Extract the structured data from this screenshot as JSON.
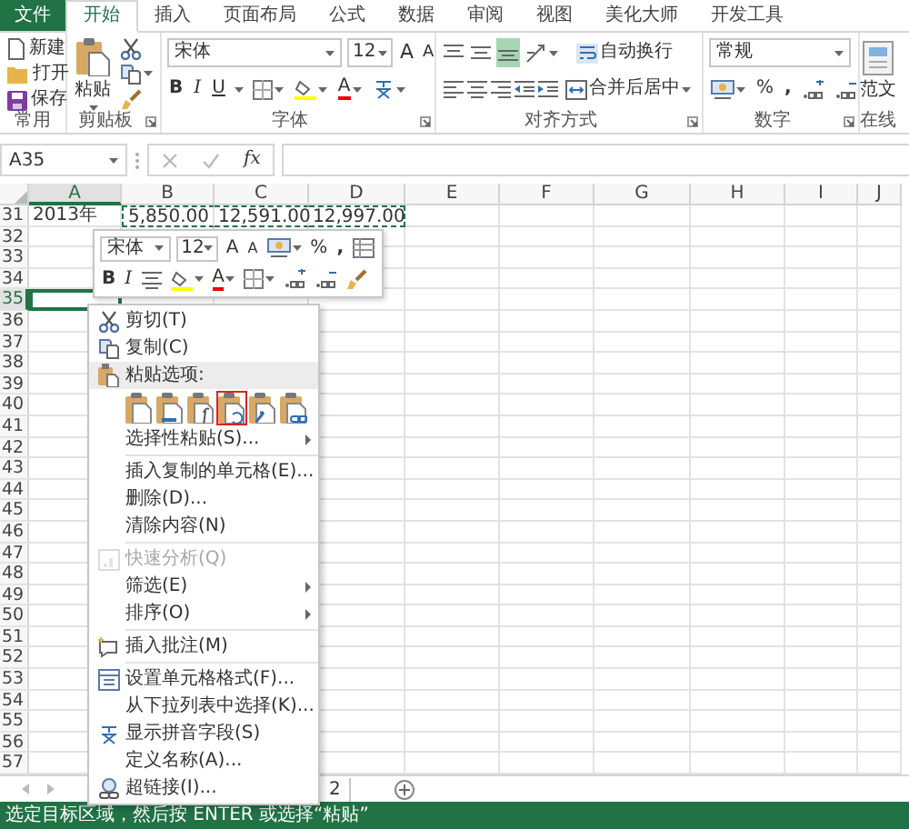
{
  "ribbon_tabs": [
    {
      "label": "文件",
      "kind": "file",
      "selected": false
    },
    {
      "label": "开始",
      "kind": "tab",
      "selected": true
    },
    {
      "label": "插入",
      "kind": "tab",
      "selected": false
    },
    {
      "label": "页面布局",
      "kind": "tab",
      "selected": false
    },
    {
      "label": "公式",
      "kind": "tab",
      "selected": false
    },
    {
      "label": "数据",
      "kind": "tab",
      "selected": false
    },
    {
      "label": "审阅",
      "kind": "tab",
      "selected": false
    },
    {
      "label": "视图",
      "kind": "tab",
      "selected": false
    },
    {
      "label": "美化大师",
      "kind": "tab",
      "selected": false
    },
    {
      "label": "开发工具",
      "kind": "tab",
      "selected": false
    }
  ],
  "ribbon": {
    "common": {
      "items": [
        "新建",
        "打开",
        "保存"
      ],
      "caption": "常用"
    },
    "clipboard": {
      "paste": "粘贴",
      "caption": "剪贴板"
    },
    "font": {
      "name": "宋体",
      "size": "12",
      "grow": "A",
      "shrink": "A",
      "bold": "B",
      "italic": "I",
      "underline": "U",
      "font_color": "A",
      "caption": "字体"
    },
    "alignment": {
      "wrap_text": "自动换行",
      "merge_center": "合并后居中",
      "caption": "对齐方式"
    },
    "number": {
      "format": "常规",
      "percent": "%",
      "comma": ",",
      "caption": "数字"
    },
    "online": {
      "button": "范文",
      "caption": "在线"
    }
  },
  "formula_bar": {
    "name_box": "A35",
    "function": "fx"
  },
  "columns": [
    {
      "label": "A",
      "selected": true
    },
    {
      "label": "B",
      "selected": false
    },
    {
      "label": "C",
      "selected": false
    },
    {
      "label": "D",
      "selected": false
    },
    {
      "label": "E",
      "selected": false
    },
    {
      "label": "F",
      "selected": false
    },
    {
      "label": "G",
      "selected": false
    },
    {
      "label": "H",
      "selected": false
    },
    {
      "label": "I",
      "selected": false
    },
    {
      "label": "J",
      "selected": false
    }
  ],
  "rows": [
    {
      "number": "31",
      "selected": false,
      "cells": [
        {
          "text": "2013年",
          "copied": false
        },
        {
          "text": "5,850.00",
          "copied": true
        },
        {
          "text": "12,591.00",
          "copied": true
        },
        {
          "text": "12,997.00",
          "copied": true
        }
      ]
    },
    {
      "number": "32",
      "selected": false
    },
    {
      "number": "33",
      "selected": false
    },
    {
      "number": "34",
      "selected": false
    },
    {
      "number": "35",
      "selected": true
    },
    {
      "number": "36",
      "selected": false
    },
    {
      "number": "37",
      "selected": false
    },
    {
      "number": "38",
      "selected": false
    },
    {
      "number": "39",
      "selected": false
    },
    {
      "number": "40",
      "selected": false
    },
    {
      "number": "41",
      "selected": false
    },
    {
      "number": "42",
      "selected": false
    },
    {
      "number": "43",
      "selected": false
    },
    {
      "number": "44",
      "selected": false
    },
    {
      "number": "45",
      "selected": false
    },
    {
      "number": "46",
      "selected": false
    },
    {
      "number": "47",
      "selected": false
    },
    {
      "number": "48",
      "selected": false
    },
    {
      "number": "49",
      "selected": false
    },
    {
      "number": "50",
      "selected": false
    },
    {
      "number": "51",
      "selected": false
    },
    {
      "number": "52",
      "selected": false
    },
    {
      "number": "53",
      "selected": false
    },
    {
      "number": "54",
      "selected": false
    },
    {
      "number": "55",
      "selected": false
    },
    {
      "number": "56",
      "selected": false
    },
    {
      "number": "57",
      "selected": false
    }
  ],
  "mini_toolbar": {
    "font": "宋体",
    "size": "12",
    "grow": "A",
    "shrink": "A",
    "percent": "%",
    "comma": ",",
    "bold": "B",
    "italic": "I",
    "font_color": "A"
  },
  "context_menu": {
    "items": [
      {
        "kind": "item",
        "label": "剪切(T)",
        "disabled": false,
        "submenu": false
      },
      {
        "kind": "item",
        "label": "复制(C)",
        "disabled": false,
        "submenu": false
      },
      {
        "kind": "header",
        "label": "粘贴选项:"
      },
      {
        "kind": "paste_options",
        "options": [
          {
            "selected": false
          },
          {
            "selected": false
          },
          {
            "selected": false
          },
          {
            "selected": true
          },
          {
            "selected": false
          },
          {
            "selected": false
          }
        ]
      },
      {
        "kind": "item",
        "label": "选择性粘贴(S)...",
        "disabled": false,
        "submenu": true
      },
      {
        "kind": "separator"
      },
      {
        "kind": "item",
        "label": "插入复制的单元格(E)...",
        "disabled": false,
        "submenu": false
      },
      {
        "kind": "item",
        "label": "删除(D)...",
        "disabled": false,
        "submenu": false
      },
      {
        "kind": "item",
        "label": "清除内容(N)",
        "disabled": false,
        "submenu": false
      },
      {
        "kind": "separator"
      },
      {
        "kind": "item",
        "label": "快速分析(Q)",
        "disabled": true,
        "submenu": false
      },
      {
        "kind": "item",
        "label": "筛选(E)",
        "disabled": false,
        "submenu": true
      },
      {
        "kind": "item",
        "label": "排序(O)",
        "disabled": false,
        "submenu": true
      },
      {
        "kind": "separator"
      },
      {
        "kind": "item",
        "label": "插入批注(M)",
        "disabled": false,
        "submenu": false
      },
      {
        "kind": "separator"
      },
      {
        "kind": "item",
        "label": "设置单元格格式(F)...",
        "disabled": false,
        "submenu": false
      },
      {
        "kind": "item",
        "label": "从下拉列表中选择(K)...",
        "disabled": false,
        "submenu": false
      },
      {
        "kind": "item",
        "label": "显示拼音字段(S)",
        "disabled": false,
        "submenu": false
      },
      {
        "kind": "item",
        "label": "定义名称(A)...",
        "disabled": false,
        "submenu": false
      },
      {
        "kind": "item",
        "label": "超链接(I)...",
        "disabled": false,
        "submenu": false
      }
    ]
  },
  "sheet_tabs": [
    {
      "label": "2",
      "selected": false
    }
  ],
  "status_bar": {
    "text": "选定目标区域，然后按 ENTER 或选择“粘贴”"
  }
}
